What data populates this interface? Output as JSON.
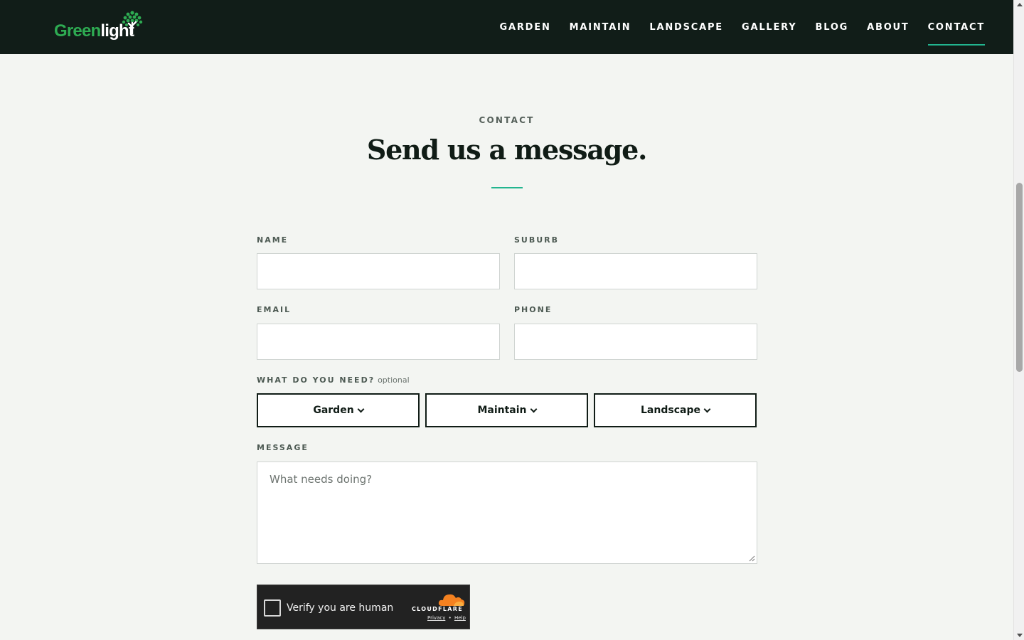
{
  "header": {
    "logo": {
      "part1": "Green",
      "part2": "light"
    },
    "nav": [
      {
        "label": "GARDEN"
      },
      {
        "label": "MAINTAIN"
      },
      {
        "label": "LANDSCAPE"
      },
      {
        "label": "GALLERY"
      },
      {
        "label": "BLOG"
      },
      {
        "label": "ABOUT"
      },
      {
        "label": "CONTACT",
        "active": true
      }
    ]
  },
  "hero": {
    "eyebrow": "CONTACT",
    "title": "Send us a message."
  },
  "form": {
    "name_label": "NAME",
    "suburb_label": "SUBURB",
    "email_label": "EMAIL",
    "phone_label": "PHONE",
    "need_label": "WHAT DO YOU NEED?",
    "need_optional": "optional",
    "services": [
      {
        "label": "Garden"
      },
      {
        "label": "Maintain"
      },
      {
        "label": "Landscape"
      }
    ],
    "message_label": "MESSAGE",
    "message_placeholder": "What needs doing?"
  },
  "captcha": {
    "text": "Verify you are human",
    "brand": "CLOUDFLARE",
    "privacy": "Privacy",
    "separator": "•",
    "help": "Help"
  },
  "colors": {
    "header_bg": "#111d18",
    "accent": "#22b58f",
    "logo_green": "#2eab52",
    "page_bg": "#f3f5f2"
  }
}
